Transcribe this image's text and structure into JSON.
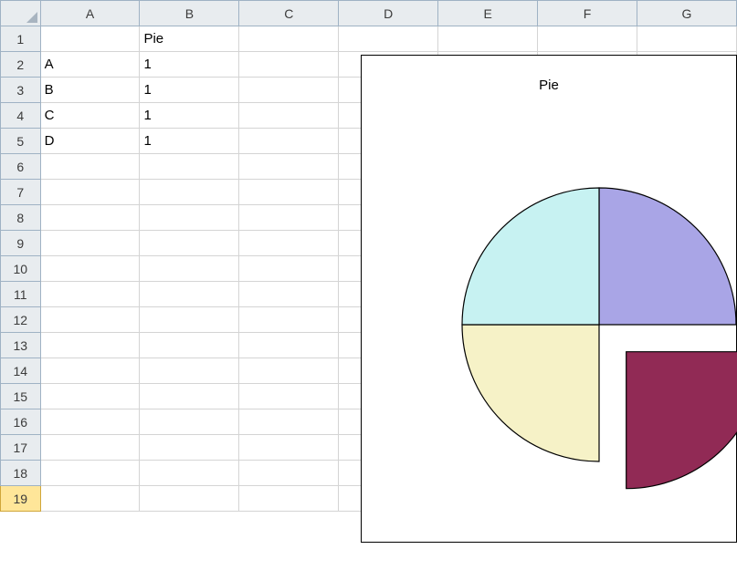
{
  "columns": [
    "A",
    "B",
    "C",
    "D",
    "E",
    "F",
    "G"
  ],
  "rows": [
    "1",
    "2",
    "3",
    "4",
    "5",
    "6",
    "7",
    "8",
    "9",
    "10",
    "11",
    "12",
    "13",
    "14",
    "15",
    "16",
    "17",
    "18",
    "19"
  ],
  "header_cell": {
    "row": 0,
    "col": 1,
    "text": "Pie",
    "bold": true
  },
  "data_cells": [
    {
      "row": 1,
      "colA": "A",
      "colB": "1"
    },
    {
      "row": 2,
      "colA": "B",
      "colB": "1"
    },
    {
      "row": 3,
      "colA": "C",
      "colB": "1"
    },
    {
      "row": 4,
      "colA": "D",
      "colB": "1"
    }
  ],
  "selected_row_index": 18,
  "chart_data": {
    "type": "pie",
    "title": "Pie",
    "categories": [
      "A",
      "B",
      "C",
      "D"
    ],
    "values": [
      1,
      1,
      1,
      1
    ],
    "series": [
      {
        "name": "Pie",
        "values": [
          1,
          1,
          1,
          1
        ]
      }
    ],
    "colors": [
      "#a9a5e6",
      "#912a55",
      "#f6f2c7",
      "#c7f2f2"
    ],
    "exploded_index": 1,
    "explode_offset": 0.28
  }
}
